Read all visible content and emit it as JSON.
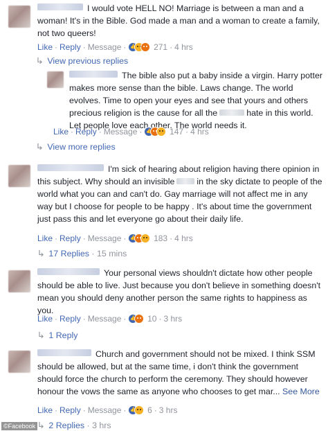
{
  "comments": [
    {
      "text": "I would vote HELL NO! Marriage is between a man and a woman! It's in the Bible. God made a man and a woman to create a family, not two queers!",
      "actions": {
        "like": "Like",
        "reply": "Reply",
        "message": "Message",
        "reactions": "271",
        "time": "4 hrs"
      },
      "previous_replies": "View previous replies",
      "reply": {
        "text_before": "The bible also put a baby inside a virgin. Harry potter makes more sense than the bible. Laws change. The world evolves. Time to open your eyes and see that yours and others precious religion is the cause for all the",
        "text_after": "hate in this world. Let people love each other. The world needs it.",
        "actions": {
          "like": "Like",
          "reply": "Reply",
          "message": "Message",
          "reactions": "147",
          "time": "4 hrs"
        }
      },
      "more_replies": "View more replies"
    },
    {
      "text_before": "I'm sick of hearing about religion having there opinion in this subject. Why should an invisible",
      "text_after": "in the sky dictate to people of the world what you can and can't do. Gay marriage will not affect me in any way but I choose for people to be happy . It's about time the government just pass this and let everyone go about their daily life.",
      "actions": {
        "like": "Like",
        "reply": "Reply",
        "message": "Message",
        "reactions": "183",
        "time": "4 hrs"
      },
      "replies_label": "17 Replies",
      "replies_time": "15 mins"
    },
    {
      "text": "Your personal views shouldn't dictate how other people should be able to live. Just because you don't believe in something doesn't mean you should deny another person the same rights to happiness as you.",
      "actions": {
        "like": "Like",
        "reply": "Reply",
        "message": "Message",
        "reactions": "10",
        "time": "3 hrs"
      },
      "replies_label": "1 Reply"
    },
    {
      "text": "Church and government should not be mixed. I think SSM should be allowed, but at the same time, i don't think the government should force the church to perform the ceremony. They should however honour the vows the same as anyone who chooses to get mar...",
      "see_more": "See More",
      "actions": {
        "like": "Like",
        "reply": "Reply",
        "message": "Message",
        "reactions": "6",
        "time": "3 hrs"
      },
      "replies_label": "2 Replies",
      "replies_time": "3 hrs"
    }
  ],
  "credit": "©Facebook",
  "colors": {
    "link": "#4267b2",
    "muted": "#90949c",
    "text": "#1d2129"
  },
  "icons": [
    "like-reaction-icon",
    "haha-reaction-icon",
    "angry-reaction-icon",
    "reply-arrow-icon"
  ]
}
